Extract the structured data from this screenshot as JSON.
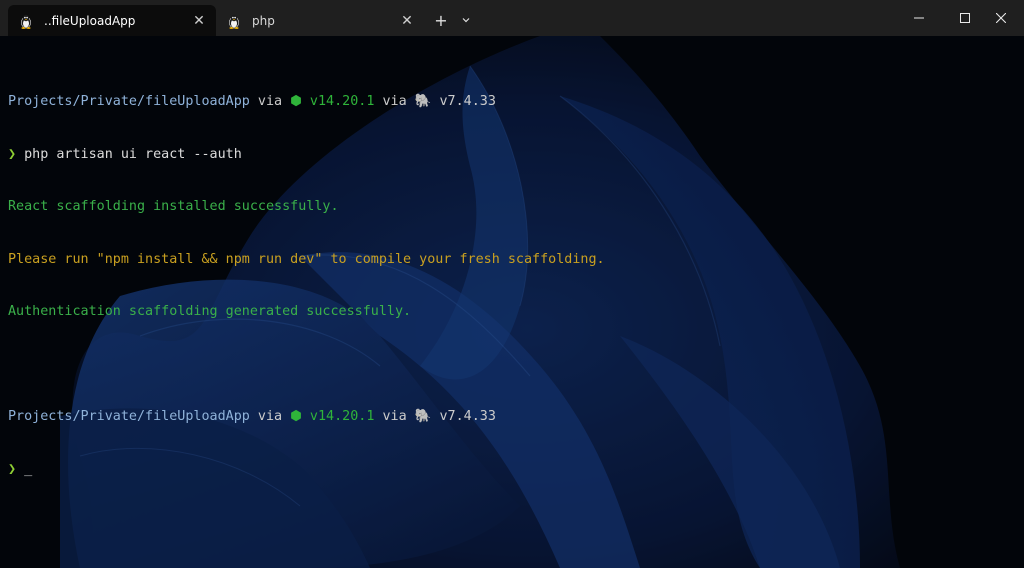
{
  "tabs": [
    {
      "title": "..fileUploadApp",
      "icon": "linux-penguin-icon",
      "active": true,
      "close": "✕"
    },
    {
      "title": "php",
      "icon": "linux-penguin-icon",
      "active": false,
      "close": "✕"
    }
  ],
  "tabbar": {
    "new_tab": "+",
    "dropdown": "⌄"
  },
  "window_controls": {
    "minimize": "—",
    "maximize": "☐",
    "close": "✕"
  },
  "terminal": {
    "prompt1": {
      "path": "Projects/Private/fileUploadApp",
      "via1": " via ",
      "node_icon": "⬢",
      "node_version": " v14.20.1",
      "via2": " via ",
      "php_icon": "🐘",
      "php_version": " v7.4.33"
    },
    "command": {
      "symbol": "❯",
      "text": " php artisan ui react --auth"
    },
    "output": [
      {
        "text": "React scaffolding installed successfully.",
        "kind": "ok"
      },
      {
        "text": "Please run \"npm install && npm run dev\" to compile your fresh scaffolding.",
        "kind": "warn"
      },
      {
        "text": "Authentication scaffolding generated successfully.",
        "kind": "ok"
      }
    ],
    "prompt2": {
      "path": "Projects/Private/fileUploadApp",
      "via1": " via ",
      "node_icon": "⬢",
      "node_version": " v14.20.1",
      "via2": " via ",
      "php_icon": "🐘",
      "php_version": " v7.4.33"
    },
    "input": {
      "symbol": "❯",
      "cursor": " _"
    }
  },
  "colors": {
    "path": "#8fb2d9",
    "node": "#2fb43a",
    "success": "#3ab04a",
    "warning": "#c9a020",
    "prompt": "#8fcf34",
    "tabbar_bg": "#1f1f1f",
    "terminal_bg": "#050a14"
  }
}
